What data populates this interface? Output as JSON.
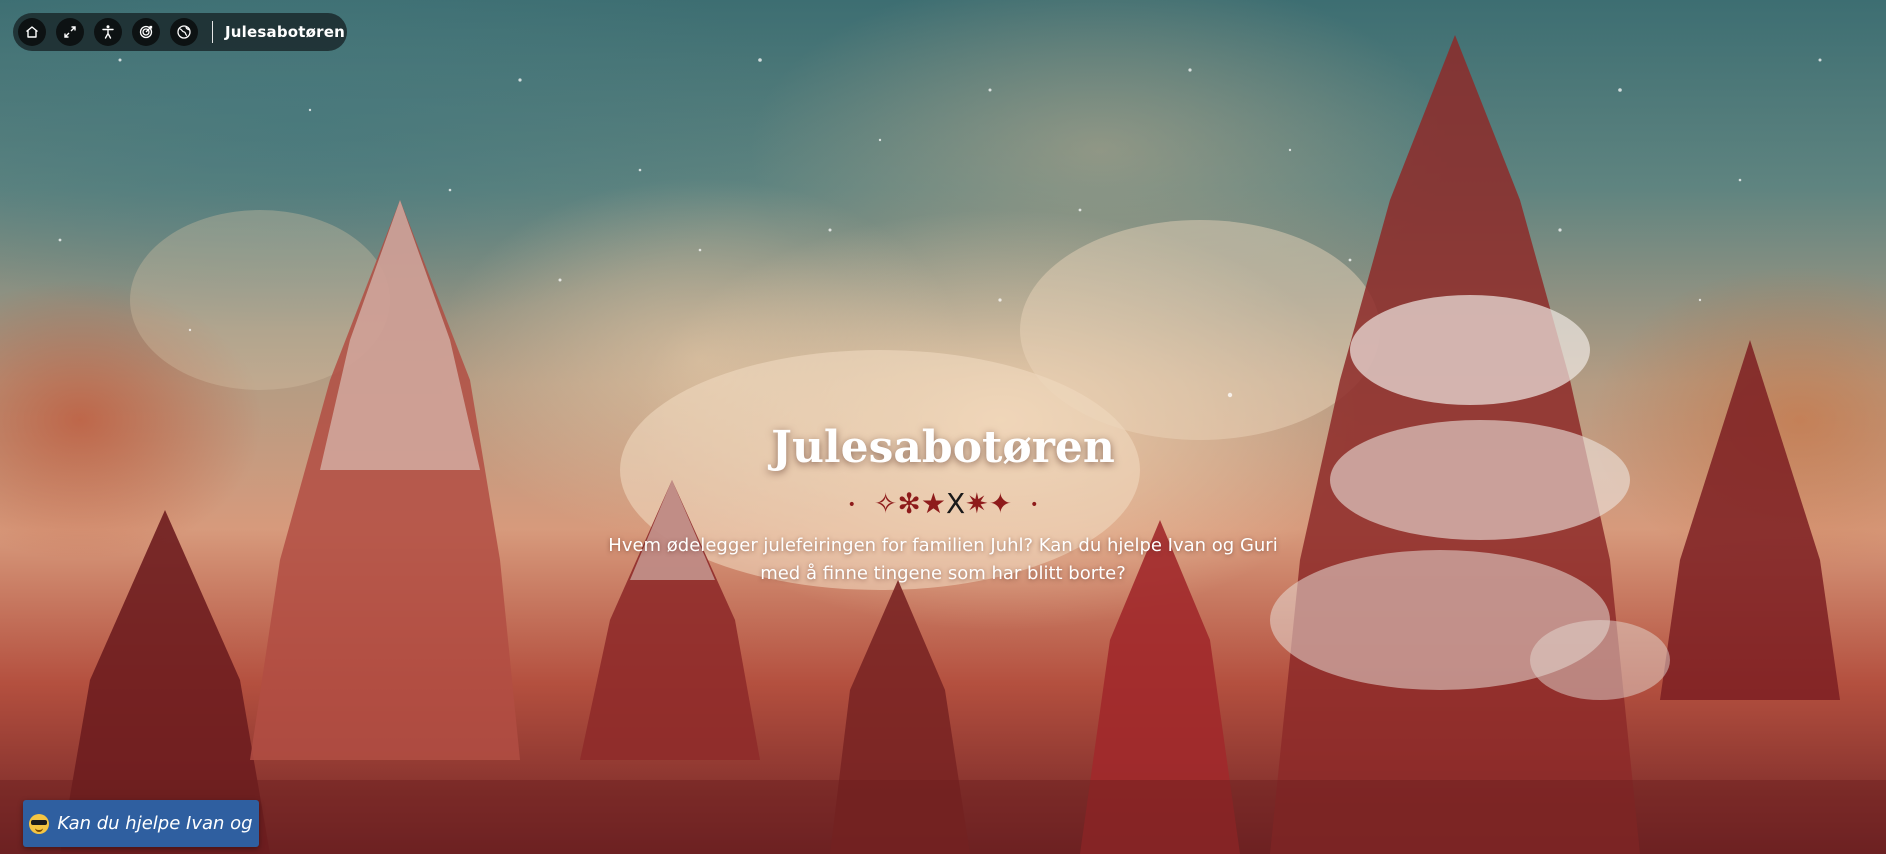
{
  "toolbar": {
    "buttons": [
      {
        "name": "home-icon",
        "label": "home"
      },
      {
        "name": "fullscreen-icon",
        "label": "fullscreen"
      },
      {
        "name": "accessibility-icon",
        "label": "accessibility"
      },
      {
        "name": "target-icon",
        "label": "target"
      },
      {
        "name": "globe-icon",
        "label": "language"
      }
    ],
    "title": "Julesabotøren"
  },
  "hero": {
    "title": "Julesabotøren",
    "divider_glyphs": "✧✻★",
    "divider_x": "X",
    "divider_glyphs_right": "✷✦",
    "dot": "•",
    "description": "Hvem ødelegger julefeiringen for familien Juhl? Kan du hjelpe Ivan og Guri med å finne tingene som har blitt borte?"
  },
  "cta": {
    "label": "Kan du hjelpe Ivan og"
  },
  "colors": {
    "toolbar_bg": "#141c1e",
    "button_bg": "#2f5fa0",
    "divider_red": "#8e1b1b"
  }
}
